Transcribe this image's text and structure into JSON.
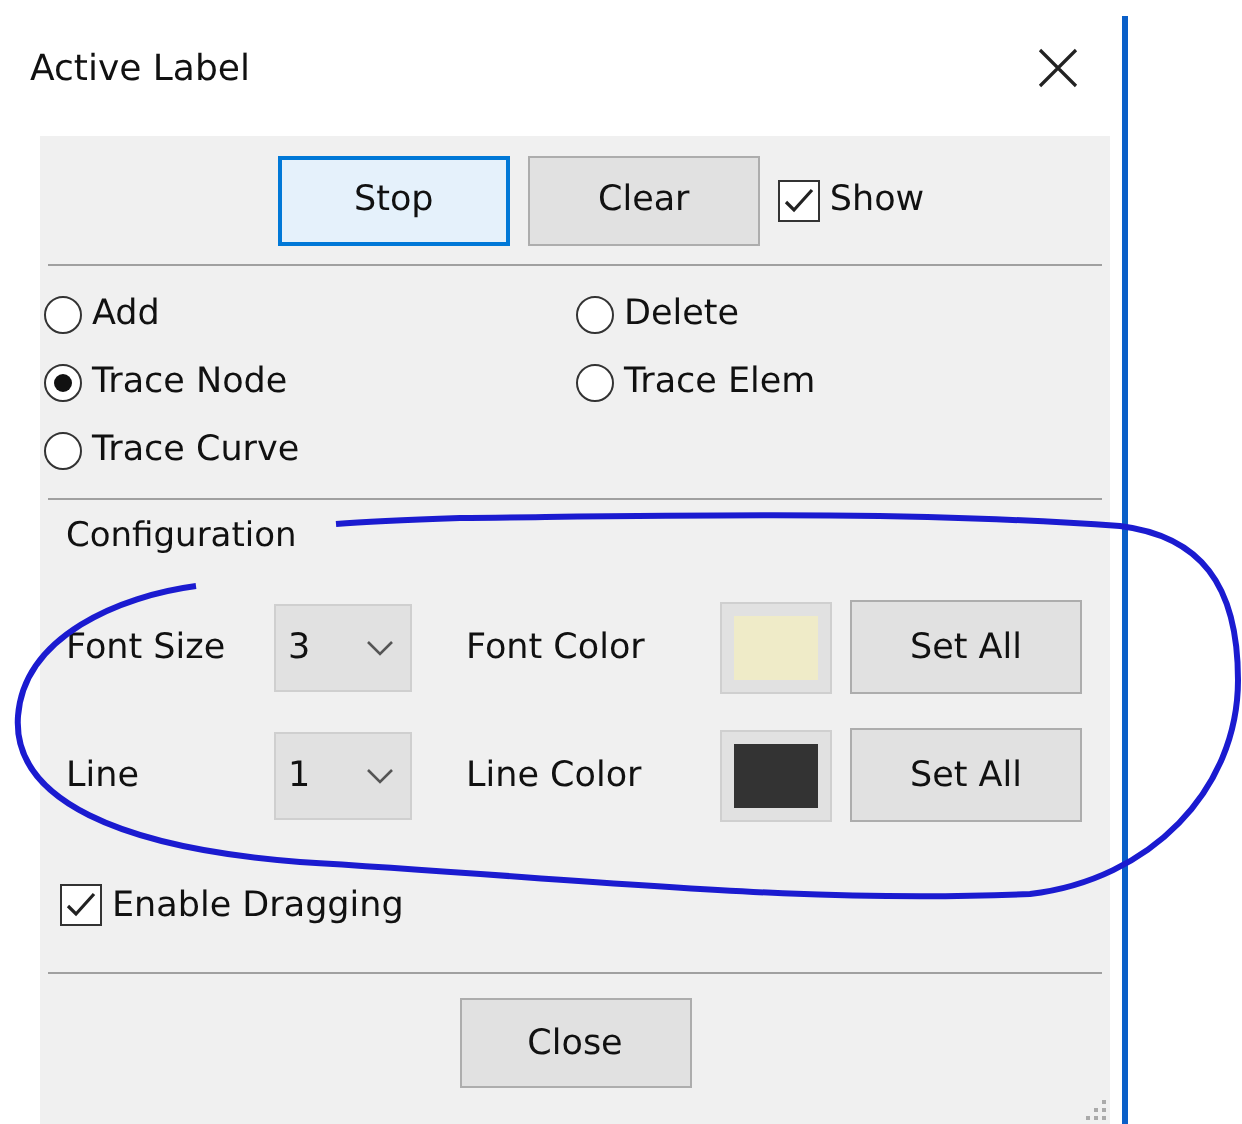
{
  "window": {
    "title": "Active Label"
  },
  "toolbar": {
    "buttons": [
      {
        "label": "Stop",
        "focused": true
      },
      {
        "label": "Clear",
        "focused": false
      }
    ],
    "show": {
      "label": "Show",
      "checked": true
    }
  },
  "modes": [
    {
      "label": "Add",
      "selected": false
    },
    {
      "label": "Delete",
      "selected": false
    },
    {
      "label": "Trace Node",
      "selected": true
    },
    {
      "label": "Trace Elem",
      "selected": false
    },
    {
      "label": "Trace Curve",
      "selected": false
    }
  ],
  "configuration": {
    "title": "Configuration",
    "rows": [
      {
        "label": "Font Size",
        "value": "3",
        "color_label": "Font Color",
        "color": "#efebc8",
        "button": "Set All"
      },
      {
        "label": "Line",
        "value": "1",
        "color_label": "Line Color",
        "color": "#333333",
        "button": "Set All"
      }
    ]
  },
  "enable_dragging": {
    "label": "Enable Dragging",
    "checked": true
  },
  "footer": {
    "button": "Close"
  }
}
